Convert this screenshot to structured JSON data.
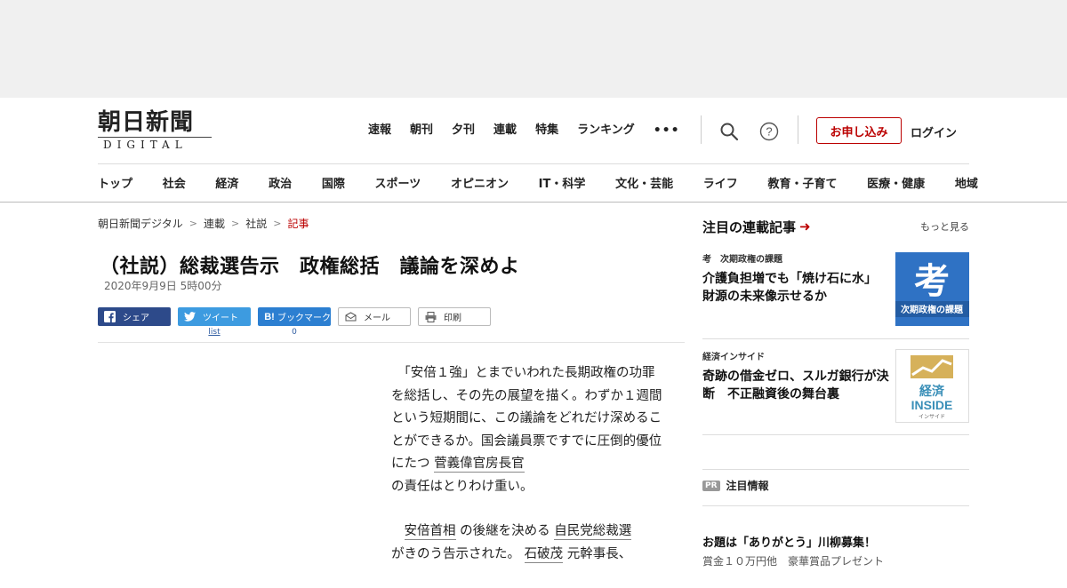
{
  "header": {
    "logo_main": "朝日新聞",
    "logo_sub": "DIGITAL",
    "topnav": [
      "速報",
      "朝刊",
      "夕刊",
      "連載",
      "特集",
      "ランキング"
    ],
    "more_label": "•••",
    "apply_label": "お申し込み",
    "login_label": "ログイン"
  },
  "catnav": [
    "トップ",
    "社会",
    "経済",
    "政治",
    "国際",
    "スポーツ",
    "オピニオン",
    "IT・科学",
    "文化・芸能",
    "ライフ",
    "教育・子育て",
    "医療・健康",
    "地域"
  ],
  "breadcrumb": [
    "朝日新聞デジタル",
    "連載",
    "社説",
    "記事"
  ],
  "article": {
    "title": "（社説）総裁選告示　政権総括　議論を深めよ",
    "date": "2020年9月9日 5時00分",
    "paragraph1": "「安倍１強」とまでいわれた長期政権の功罪を総括し、その先の展望を描く。わずか１週間という短期間に、この議論をどれだけ深めることができるか。国会議員票ですでに圧倒的優位にたつ",
    "p1_link": "菅義偉官房長官",
    "p1_tail": "の責任はとりわけ重い。",
    "p2_link1": "安倍首相",
    "p2_mid1": "の後継を決める",
    "p2_link2": "自民党総裁選",
    "p2_mid2": "がきのう告示された。",
    "p2_link3": "石破茂",
    "p2_tail": "元幹事長、"
  },
  "share": {
    "facebook": "シェア",
    "twitter": "ツイート",
    "twitter_count": "list",
    "hatena": "ブックマーク",
    "hatena_count": "0",
    "mail": "メール",
    "print": "印刷"
  },
  "sidebar": {
    "heading": "注目の連載記事",
    "more": "もっと見る",
    "items": [
      {
        "tag": "考　次期政権の課題",
        "headline": "介護負担増でも「焼け石に水」　財源の未来像示せるか",
        "thumb_caption": "次期政権の課題",
        "thumb_kanji": "考"
      },
      {
        "tag": "経済インサイド",
        "headline": "奇跡の借金ゼロ、スルガ銀行が決断　不正融資後の舞台裏",
        "thumb_line1": "経済",
        "thumb_line2": "INSIDE",
        "thumb_line3": "インサイド"
      }
    ],
    "pr_badge": "PR",
    "pr_label": "注目情報",
    "pr_title": "お題は「ありがとう」川柳募集！",
    "pr_sub": "賞金１０万円他　豪華賞品プレゼント"
  },
  "colors": {
    "accent": "#bb0000",
    "facebook": "#2d4a8a",
    "twitter": "#3d9be0",
    "hatena": "#2c7fd1"
  }
}
